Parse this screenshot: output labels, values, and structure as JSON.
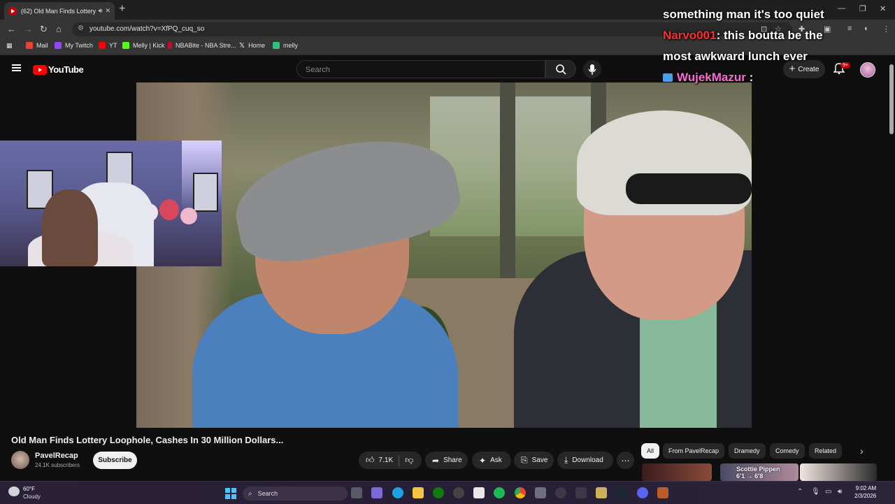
{
  "browser": {
    "tab_title": "(62) Old Man Finds Lottery",
    "url": "youtube.com/watch?v=XfPQ_cuq_so",
    "bookmarks": [
      "Mail",
      "My Twitch",
      "YT",
      "Melly | Kick",
      "NBABite - NBA Stre...",
      "Home",
      "melly"
    ]
  },
  "yt_header": {
    "logo": "YouTube",
    "search_placeholder": "Search",
    "create_label": "Create",
    "notif_badge": "9+"
  },
  "chat": {
    "line1": "something man it's too quiet",
    "user1": "Narvo001",
    "msg1a": ": this boutta be the",
    "msg1b": "most awkward lunch ever",
    "user2": "WujekMazur",
    "msg2": " :"
  },
  "video_info": {
    "title": "Old Man Finds Lottery Loophole, Cashes In 30 Million Dollars...",
    "channel": "PavelRecap",
    "subscribers": "24.1K subscribers",
    "subscribe_label": "Subscribe",
    "likes": "7.1K",
    "share_label": "Share",
    "ask_label": "Ask",
    "save_label": "Save",
    "download_label": "Download"
  },
  "chips": [
    "All",
    "From PavelRecap",
    "Dramedy",
    "Comedy",
    "Related"
  ],
  "reco": {
    "label_line1": "Scottie Pippen",
    "label_line2": "6'1 → 6'8"
  },
  "taskbar": {
    "temp": "60°F",
    "condition": "Cloudy",
    "search_label": "Search",
    "time": "9:02 AM",
    "date": "2/3/2026"
  },
  "colors": {
    "yt_red": "#ff0000",
    "chat_user1": "#ff2d2d",
    "chat_user2": "#ff6ad5",
    "taskbar_bg": "#2a2038"
  }
}
